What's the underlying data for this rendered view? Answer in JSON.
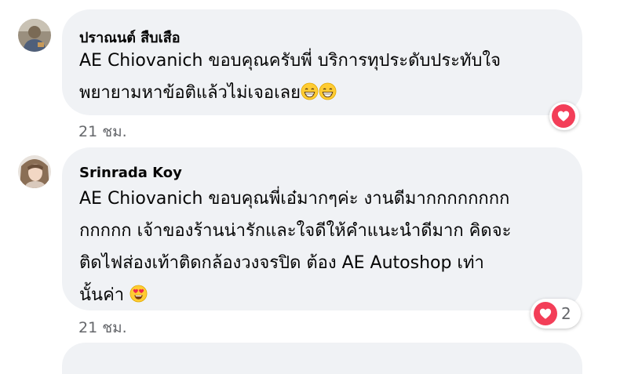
{
  "comments": [
    {
      "author": "ปราณนต์ สืบเสือ",
      "lines": [
        "AE Chiovanich ขอบคุณครับพี่ บริการทุประดับประทับใจ",
        "พยายามหาข้อติแล้วไม่เจอเลย"
      ],
      "line2_emojis": [
        "grinning-face-emoji",
        "grinning-face-emoji"
      ],
      "timestamp": "21 ชม.",
      "reaction": {
        "icon": "heart-icon",
        "count": ""
      }
    },
    {
      "author": "Srinrada Koy",
      "lines": [
        "AE Chiovanich ขอบคุณพี่เอ๋มากๆค่ะ งานดีมากกกกกกกก",
        "กกกกก เจ้าของร้านน่ารักและใจดีให้คำแนะนำดีมาก คิดจะ",
        "ติดไฟส่องเท้าติดกล้องวงจรปิด ต้อง AE Autoshop เท่า",
        "นั้นค่า"
      ],
      "line4_emojis": [
        "heart-eyes-emoji"
      ],
      "timestamp": "21 ชม.",
      "reaction": {
        "icon": "heart-icon",
        "count": "2"
      }
    }
  ],
  "colors": {
    "bubble": "#f0f2f5",
    "text": "#050505",
    "meta": "#65676b",
    "love": "#f33e58"
  }
}
